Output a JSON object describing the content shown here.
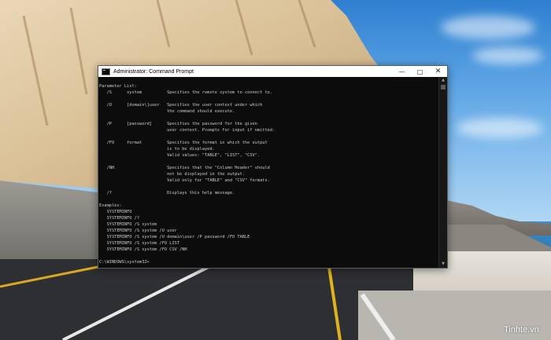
{
  "window": {
    "title": "Administrator: Command Prompt",
    "minimize_icon": "minimize-icon",
    "maximize_icon": "maximize-icon",
    "close_icon": "close-icon"
  },
  "console": {
    "lines": [
      "Parameter List:",
      "   /S      system          Specifies the remote system to connect to.",
      "",
      "   /U      [domain\\]user   Specifies the user context under which",
      "                           the command should execute.",
      "",
      "   /P      [password]      Specifies the password for the given",
      "                           user context. Prompts for input if omitted.",
      "",
      "   /FO     format          Specifies the format in which the output",
      "                           is to be displayed.",
      "                           Valid values: \"TABLE\", \"LIST\", \"CSV\".",
      "",
      "   /NH                     Specifies that the \"Column Header\" should",
      "                           not be displayed in the output.",
      "                           Valid only for \"TABLE\" and \"CSV\" formats.",
      "",
      "   /?                      Displays this help message.",
      "",
      "Examples:",
      "   SYSTEMINFO",
      "   SYSTEMINFO /?",
      "   SYSTEMINFO /S system",
      "   SYSTEMINFO /S system /U user",
      "   SYSTEMINFO /S system /U domain\\user /P password /FO TABLE",
      "   SYSTEMINFO /S system /FO LIST",
      "   SYSTEMINFO /S system /FO CSV /NH",
      "",
      "C:\\WINDOWS\\system32>"
    ]
  },
  "watermark": "Tinhte.vn",
  "colors": {
    "console_bg": "#0c0c0c",
    "console_text": "#cccccc",
    "titlebar_bg": "#ffffff"
  }
}
